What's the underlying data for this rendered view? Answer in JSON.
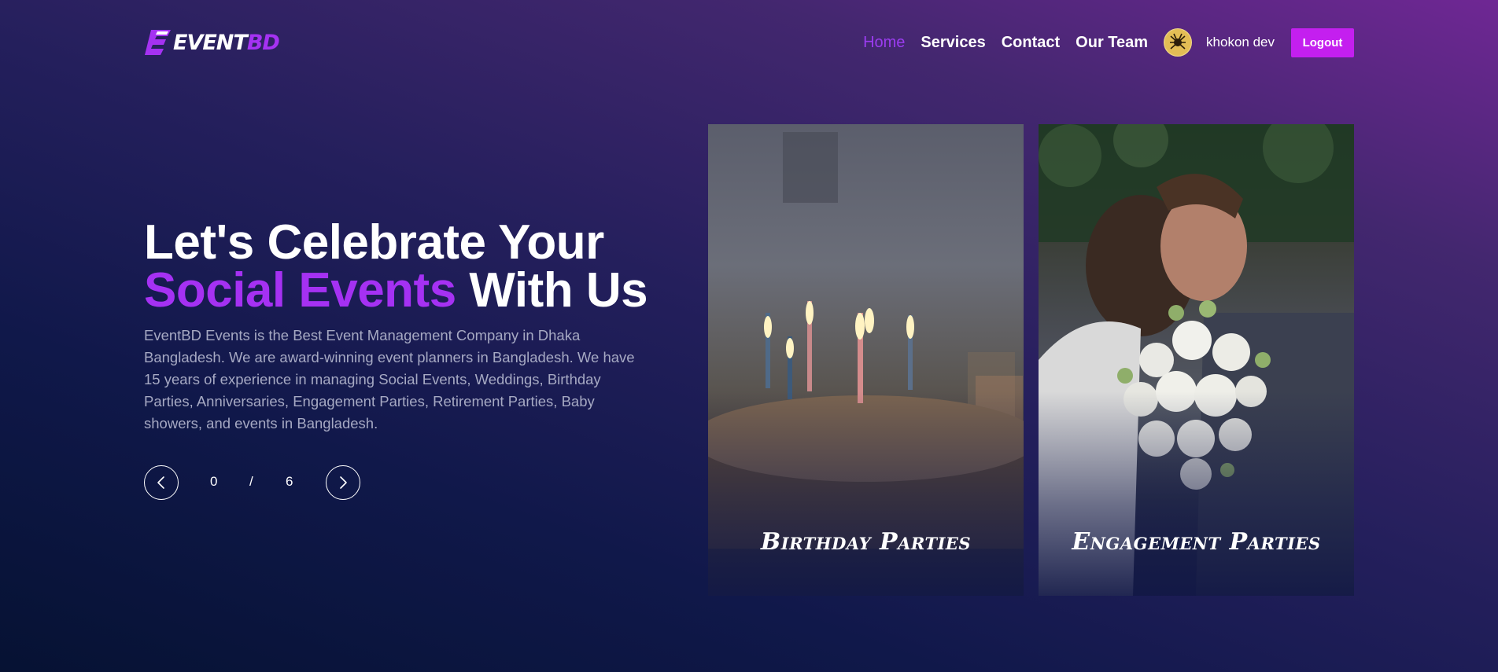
{
  "nav": {
    "logo_event": "EVENT",
    "logo_bd": "BD",
    "menu": [
      {
        "label": "Home",
        "active": true
      },
      {
        "label": "Services",
        "active": false
      },
      {
        "label": "Contact",
        "active": false
      },
      {
        "label": "Our Team",
        "active": false
      }
    ],
    "username": "khokon dev",
    "logout_label": "Logout"
  },
  "hero": {
    "title_line1": "Let's Celebrate Your",
    "title_accent": "Social Events",
    "title_rest": " With Us",
    "description": "EventBD Events is the Best Event Management Company in Dhaka Bangladesh. We are award-winning event planners in Bangladesh. We have 15 years of experience in managing Social Events, Weddings, Birthday Parties, Anniversaries, Engagement Parties, Retirement Parties, Baby showers, and events in Bangladesh."
  },
  "slider": {
    "current": "0",
    "separator": "/",
    "total": "6",
    "prev_icon": "chevron-left-icon",
    "next_icon": "chevron-right-icon"
  },
  "cards": [
    {
      "label": "Birthday Parties",
      "image": "birthday-cake-candles"
    },
    {
      "label": "Engagement Parties",
      "image": "couple-bouquet"
    }
  ],
  "colors": {
    "accent": "#a531f3",
    "logout": "#c41fef",
    "active_menu": "#9b3cf0"
  }
}
